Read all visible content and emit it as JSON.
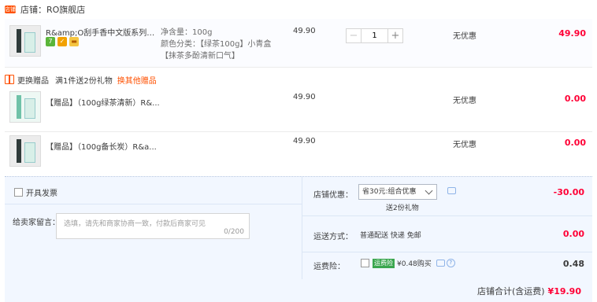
{
  "shop": {
    "badge": "店铺",
    "name": "店铺：RO旗舰店"
  },
  "main_item": {
    "title": "R&amp;O刮手香中文版系列清...",
    "badge_icons": [
      "seven-day-return-icon",
      "service-icon",
      "card-icon"
    ],
    "sku_lines": [
      "净含量：100g",
      "颜色分类：【绿茶100g】小青盒",
      "【抹茶多酚清新口气】"
    ],
    "price": "49.90",
    "quantity": "1",
    "minus": "−",
    "plus": "+",
    "discount": "无优惠",
    "total": "49.90"
  },
  "gift_bar": {
    "label": "更换赠品",
    "desc": "满1件送2份礼物",
    "link": "换其他赠品"
  },
  "gifts": [
    {
      "title": "【赠品】（100g绿茶清新）R&...",
      "price": "49.90",
      "discount": "无优惠",
      "total": "0.00"
    },
    {
      "title": "【赠品】（100g备长炭）R&a...",
      "price": "49.90",
      "discount": "无优惠",
      "total": "0.00"
    }
  ],
  "invoice": {
    "label": "开具发票"
  },
  "message": {
    "label": "给卖家留言：",
    "placeholder": "选填，请先和商家协商一致，付款后商家可见",
    "count": "0/200"
  },
  "coupon": {
    "label": "店铺优惠：",
    "selected": "省30元:组合优惠",
    "sub": "送2份礼物",
    "value": "-30.00"
  },
  "shipping": {
    "label": "运送方式：",
    "value": "普通配送 快递 免邮",
    "price": "0.00"
  },
  "insurance": {
    "label": "运费险：",
    "tag": "运费险",
    "text": "¥0.48购买",
    "help": "?",
    "price": "0.48"
  },
  "summary": {
    "label": "店铺合计(含运费)",
    "amount": "¥19.90"
  }
}
